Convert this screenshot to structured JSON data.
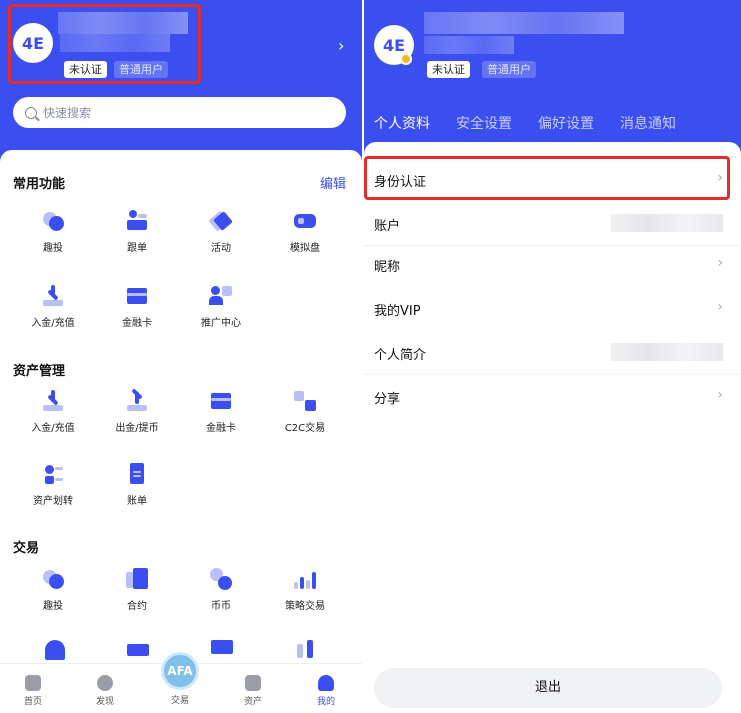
{
  "left": {
    "avatar_text": "4E",
    "tags": [
      "未认证",
      "普通用户"
    ],
    "chevron": "›",
    "search_placeholder": "快速搜索",
    "sections": [
      {
        "title": "常用功能",
        "edit": "编辑",
        "items": [
          {
            "label": "趣投",
            "icon": "pie-icon"
          },
          {
            "label": "跟单",
            "icon": "follow-icon"
          },
          {
            "label": "活动",
            "icon": "tag-icon"
          },
          {
            "label": "模拟盘",
            "icon": "gamepad-icon"
          },
          {
            "label": "入金/充值",
            "icon": "download-icon"
          },
          {
            "label": "金融卡",
            "icon": "card-icon"
          },
          {
            "label": "推广中心",
            "icon": "promote-icon"
          }
        ]
      },
      {
        "title": "资产管理",
        "items": [
          {
            "label": "入金/充值",
            "icon": "download-icon"
          },
          {
            "label": "出金/提币",
            "icon": "upload-icon"
          },
          {
            "label": "金融卡",
            "icon": "card-icon"
          },
          {
            "label": "C2C交易",
            "icon": "c2c-icon"
          },
          {
            "label": "资产划转",
            "icon": "transfer-icon"
          },
          {
            "label": "账单",
            "icon": "bill-icon"
          }
        ]
      },
      {
        "title": "交易",
        "items": [
          {
            "label": "趣投",
            "icon": "pie-icon"
          },
          {
            "label": "合约",
            "icon": "contract-icon"
          },
          {
            "label": "币币",
            "icon": "coin-icon"
          },
          {
            "label": "策略交易",
            "icon": "strategy-icon"
          }
        ]
      }
    ],
    "tabbar": [
      {
        "label": "首页",
        "icon": "home-icon"
      },
      {
        "label": "发现",
        "icon": "discover-icon"
      },
      {
        "label": "交易",
        "icon": "trade-icon"
      },
      {
        "label": "资产",
        "icon": "wallet-icon"
      },
      {
        "label": "我的",
        "icon": "user-icon"
      }
    ],
    "center_logo": "AFA"
  },
  "right": {
    "avatar_text": "4E",
    "tags": [
      "未认证",
      "普通用户"
    ],
    "tabs": [
      "个人资料",
      "安全设置",
      "偏好设置",
      "消息通知"
    ],
    "rows": [
      {
        "label": "身份认证",
        "type": "arrow"
      },
      {
        "label": "账户",
        "type": "value"
      },
      {
        "label": "昵称",
        "type": "arrow"
      },
      {
        "label": "我的VIP",
        "type": "arrow"
      },
      {
        "label": "个人简介",
        "type": "value"
      },
      {
        "label": "分享",
        "type": "arrow"
      }
    ],
    "logout": "退出"
  },
  "colors": {
    "primary": "#3b4ef0",
    "highlight": "#e62b2b"
  }
}
